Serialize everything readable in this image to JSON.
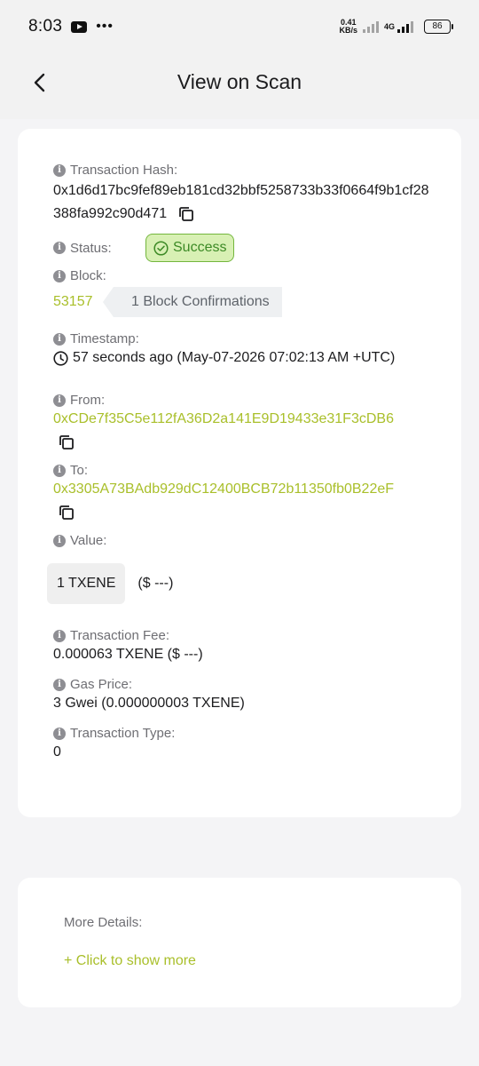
{
  "status_bar": {
    "time": "8:03",
    "dots": "•••",
    "speed_value": "0.41",
    "speed_unit": "KB/s",
    "network": "4G",
    "battery": "86"
  },
  "header": {
    "title": "View on Scan"
  },
  "transaction": {
    "hash_label": "Transaction Hash:",
    "hash_value": "0x1d6d17bc9fef89eb181cd32bbf5258733b33f0664f9b1cf28388fa992c90d471",
    "status_label": "Status:",
    "status_value": "Success",
    "block_label": "Block:",
    "block_value": "53157",
    "confirmations": "1 Block Confirmations",
    "timestamp_label": "Timestamp:",
    "timestamp_value": "57 seconds ago (May-07-2026 07:02:13 AM +UTC)",
    "from_label": "From:",
    "from_value": "0xCDe7f35C5e112fA36D2a141E9D19433e31F3cDB6",
    "to_label": "To:",
    "to_value": "0x3305A73BAdb929dC12400BCB72b11350fb0B22eF",
    "value_label": "Value:",
    "value_amount": "1 TXENE",
    "value_usd": "($ ---)",
    "fee_label": "Transaction Fee:",
    "fee_value": "0.000063 TXENE ($ ---)",
    "gas_label": "Gas Price:",
    "gas_value": "3 Gwei (0.000000003 TXENE)",
    "type_label": "Transaction Type:",
    "type_value": "0"
  },
  "more": {
    "label": "More Details:",
    "link": "+ Click to show more"
  },
  "colors": {
    "accent_green": "#a9bf2a",
    "success_bg": "#d8f0b4",
    "success_border": "#73b63d",
    "success_text": "#3c8a25"
  }
}
